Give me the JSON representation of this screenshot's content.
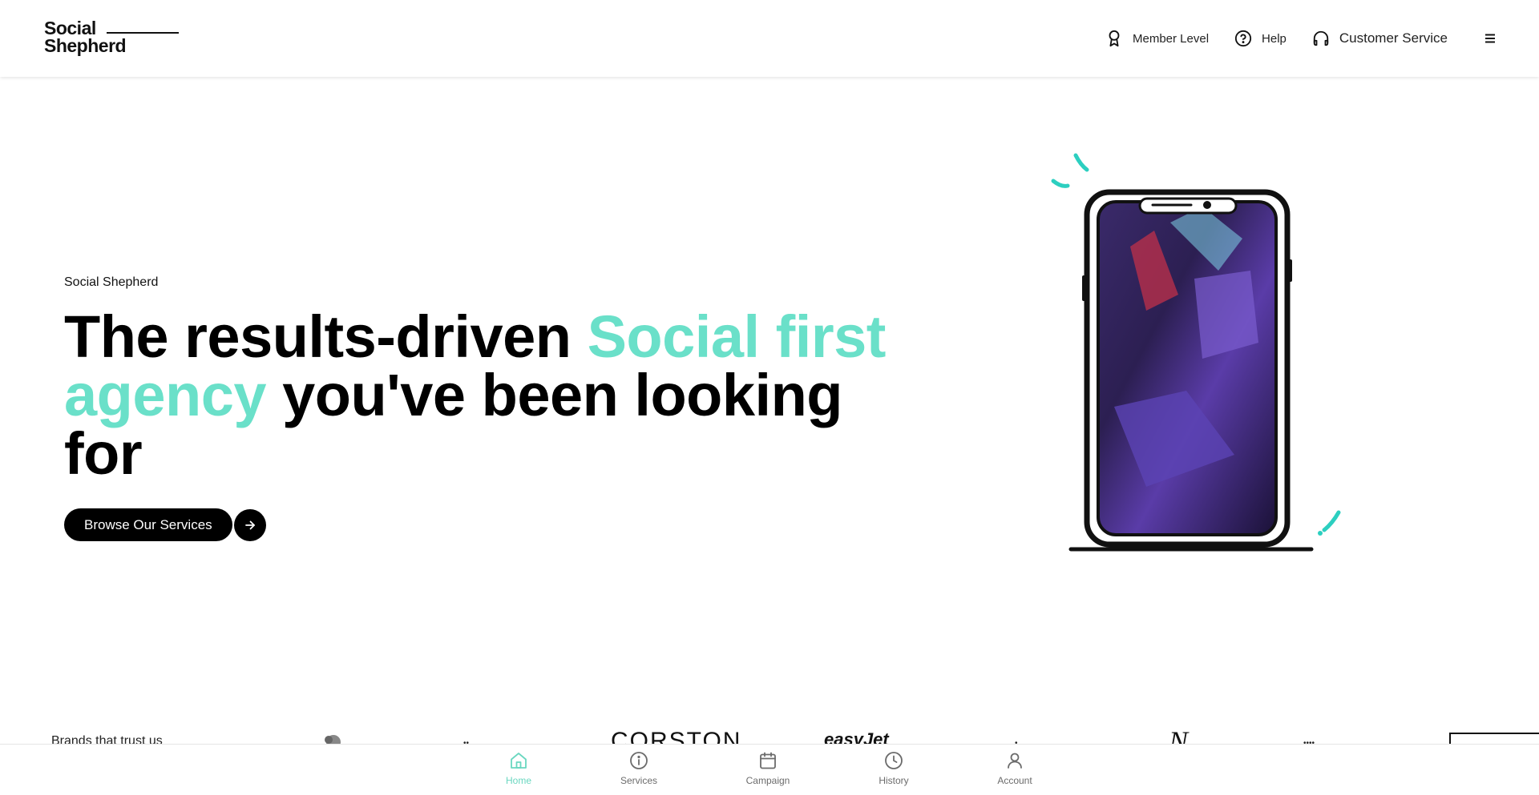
{
  "logo": {
    "line1": "Social",
    "line2": "Shepherd"
  },
  "header": {
    "nav": [
      {
        "label": "Member Level",
        "icon": "award-icon"
      },
      {
        "label": "Help",
        "icon": "help-circle-icon"
      },
      {
        "label": "Customer Service",
        "icon": "headphones-icon"
      }
    ],
    "menu_icon": "hamburger-menu-icon"
  },
  "hero": {
    "eyebrow": "Social Shepherd",
    "title_part1": "The results-driven ",
    "title_accent": "Social first agency",
    "title_part2": " you've been looking for",
    "cta_label": "Browse Our Services",
    "cta_icon": "arrow-right-icon"
  },
  "brands": {
    "label": "Brands that trust us",
    "logos": [
      "CORSTON",
      "easyJet",
      "N"
    ]
  },
  "bottom_nav": [
    {
      "label": "Home",
      "icon": "home-icon",
      "active": true
    },
    {
      "label": "Services",
      "icon": "info-icon",
      "active": false
    },
    {
      "label": "Campaign",
      "icon": "calendar-icon",
      "active": false
    },
    {
      "label": "History",
      "icon": "clock-icon",
      "active": false
    },
    {
      "label": "Account",
      "icon": "user-icon",
      "active": false
    }
  ],
  "colors": {
    "accent": "#6ae0c9",
    "accent_nav": "#6ad7c0",
    "text": "#000000",
    "muted": "#6b6b6b"
  }
}
